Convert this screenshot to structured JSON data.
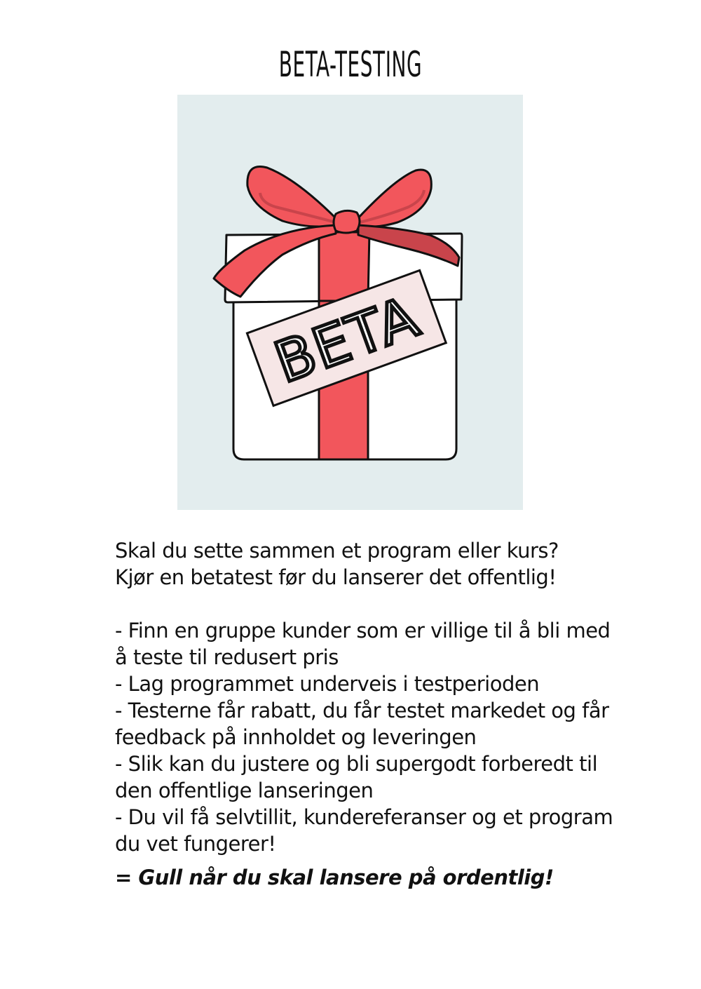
{
  "title": "BETA-TESTING",
  "illustration": {
    "tag_text": "BETA",
    "colors": {
      "background": "#e3edee",
      "ribbon": "#f2565c",
      "ribbon_dark": "#c9444b",
      "tag": "#f6e6e6",
      "box": "#ffffff",
      "outline": "#111111"
    },
    "icon": "gift-box-icon"
  },
  "intro": {
    "line1": "Skal du sette sammen et program eller kurs?",
    "line2": "Kjør en betatest før du lanserer det offentlig!"
  },
  "bullets": [
    "- Finn en gruppe kunder som er villige til å bli med å teste til redusert pris",
    "- Lag programmet underveis i testperioden",
    "- Testerne får rabatt, du får testet markedet og får feedback på innholdet og leveringen",
    "- Slik kan du justere og bli supergodt forberedt til den offentlige lanseringen",
    "- Du vil få selvtillit, kundereferanser og et program du vet fungerer!"
  ],
  "conclusion": "= Gull når du skal lansere på ordentlig!"
}
